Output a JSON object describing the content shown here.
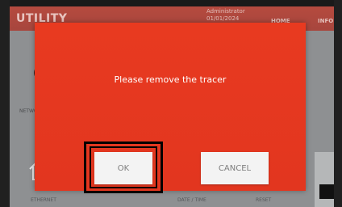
{
  "app": {
    "title": "UTILITY"
  },
  "header": {
    "user_line1": "Administrator",
    "user_line2": "01/01/2024",
    "nav_home": "HOME",
    "nav_info": "INFO"
  },
  "background": {
    "network_label": "NETWORK",
    "bottom_labels": [
      "ETHERNET",
      "DATE / TIME",
      "RESET"
    ]
  },
  "dialog": {
    "message": "Please remove the tracer",
    "ok_label": "OK",
    "cancel_label": "CANCEL"
  },
  "colors": {
    "dialog_background": "#e83a20",
    "header_background": "#b54a3f",
    "button_background": "#f3f3f3",
    "focus_outline": "#000000"
  },
  "focused_button": "OK"
}
